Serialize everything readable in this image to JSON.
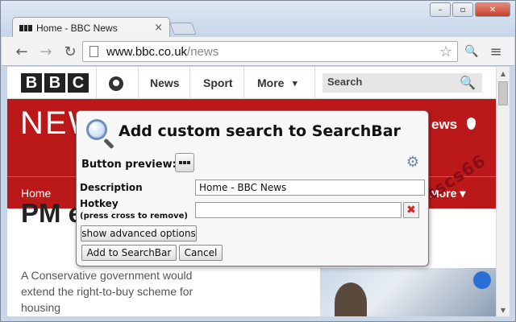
{
  "browser": {
    "tab_title": "Home - BBC News",
    "tab_close_glyph": "×",
    "window_controls": {
      "minimize": "–",
      "maximize": "▫",
      "close": "✕"
    },
    "url_host": "www.bbc.co.uk",
    "url_path": "/news",
    "nav": {
      "back": "←",
      "forward": "→",
      "reload": "↻",
      "star": "☆",
      "search_ext": "🔍",
      "menu": "≡"
    }
  },
  "bbc": {
    "logo": [
      "B",
      "B",
      "C"
    ],
    "nav_items": [
      "News",
      "Sport",
      "More"
    ],
    "more_caret": "▾",
    "search_label": "Search",
    "search_glyph": "🔍",
    "section_title": "NEW",
    "region_label": "ews",
    "subnav_home": "Home",
    "subnav_more": "More ▾",
    "headline": "PM  exte",
    "summary": "A Conservative government would extend the right-to-buy scheme for housing"
  },
  "dialog": {
    "title": "Add custom search to SearchBar",
    "button_preview_label": "Button preview:",
    "description_label": "Description",
    "description_value": "Home - BBC News",
    "hotkey_label": "Hotkey",
    "hotkey_hint": "(press cross to remove)",
    "hotkey_value": "",
    "clear_glyph": "✖",
    "advanced_button": "show advanced options",
    "add_button": "Add to SearchBar",
    "cancel_button": "Cancel",
    "gear_glyph": "⚙"
  },
  "watermark": "数码科tscs66",
  "scrollbar": {
    "up": "▲",
    "down": "▼"
  }
}
